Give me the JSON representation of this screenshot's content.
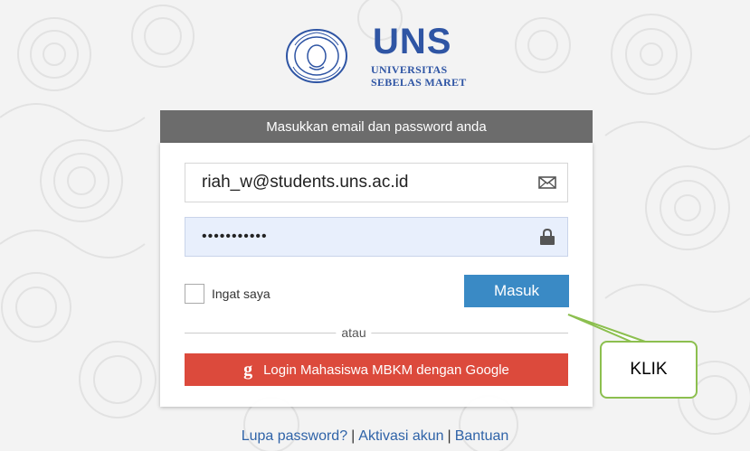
{
  "brand": {
    "name": "UNS",
    "subtitle_line1": "UNIVERSITAS",
    "subtitle_line2": "SEBELAS MARET",
    "color": "#2f55a4"
  },
  "login": {
    "header": "Masukkan email dan password anda",
    "email_value": "riah_w@students.uns.ac.id",
    "email_icon": "envelope-icon",
    "password_value": "•••••••••••",
    "password_icon": "lock-icon",
    "remember_label": "Ingat saya",
    "submit_label": "Masuk",
    "divider_label": "atau",
    "google_icon_glyph": "g",
    "google_label": "Login Mahasiswa MBKM dengan Google"
  },
  "callout": {
    "label": "KLIK",
    "border_color": "#8cbf4f"
  },
  "footer": {
    "forgot": "Lupa password?",
    "activate": "Aktivasi akun",
    "help": "Bantuan",
    "separator": "|"
  },
  "colors": {
    "header_bg": "#6c6c6c",
    "submit_bg": "#3a8ac5",
    "google_bg": "#dc4a3c",
    "link": "#2f63a8"
  }
}
